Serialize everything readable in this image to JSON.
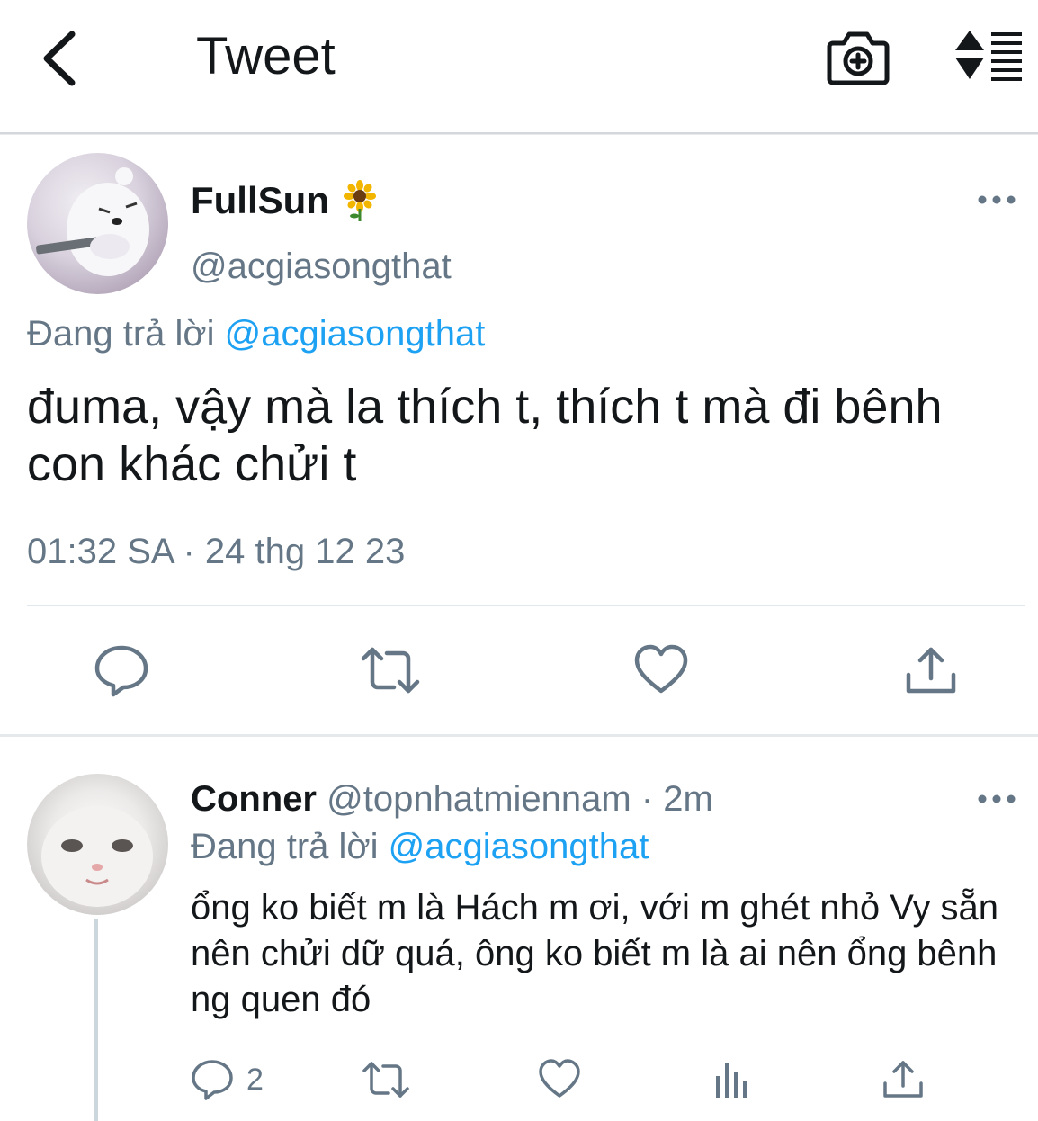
{
  "header": {
    "title": "Tweet",
    "back_icon": "chevron-left-icon",
    "camera_icon": "camera-plus-icon",
    "sort_icon": "sort-lines-icon"
  },
  "main_tweet": {
    "name": "FullSun",
    "emoji": "🌻",
    "handle": "@acgiasongthat",
    "replying_prefix": "Đang trả lời",
    "replying_to": "@acgiasongthat",
    "text": "đuma, vậy mà la thích t, thích t mà đi bênh con khác chửi t",
    "timestamp": "01:32 SA · 24 thg 12 23"
  },
  "reply_tweet": {
    "name": "Conner",
    "handle_time": "@topnhatmiennam · 2m",
    "replying_prefix": "Đang trả lời",
    "replying_to": "@acgiasongthat",
    "text": "ổng ko biết m là Hách m ơi, với m ghét nhỏ Vy sẵn nên chửi dữ quá, ông ko biết m là ai nên ổng bênh ng quen đó",
    "reply_count": "2"
  },
  "colors": {
    "text": "#14171a",
    "secondary": "#657786",
    "link": "#1da1f2",
    "divider": "#e1e8ed"
  }
}
